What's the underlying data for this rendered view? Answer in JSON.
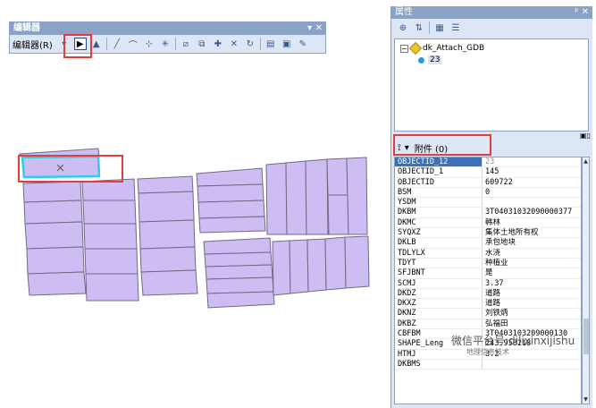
{
  "editor": {
    "title": "编辑器",
    "menu_label": "编辑器(R)",
    "title_controls": "▾ ✕"
  },
  "panel": {
    "title": "属性",
    "title_controls": "ᵖ ✕",
    "tree": {
      "layer_name": "dk_Attach_GDB",
      "feature_id": "23"
    },
    "attachments_label": "附件 (0)"
  },
  "attributes": [
    {
      "field": "OBJECTID_12",
      "value": "23"
    },
    {
      "field": "OBJECTID_1",
      "value": "145"
    },
    {
      "field": "OBJECTID",
      "value": "609722"
    },
    {
      "field": "BSM",
      "value": "0"
    },
    {
      "field": "YSDM",
      "value": ""
    },
    {
      "field": "DKBM",
      "value": "3T04031032090000377"
    },
    {
      "field": "DKMC",
      "value": "韩林"
    },
    {
      "field": "SYQXZ",
      "value": "集体土地所有权"
    },
    {
      "field": "DKLB",
      "value": "承包地块"
    },
    {
      "field": "TDLYLX",
      "value": "水浇"
    },
    {
      "field": "TDYT",
      "value": "种植业"
    },
    {
      "field": "SFJBNT",
      "value": "是"
    },
    {
      "field": "SCMJ",
      "value": "3.37"
    },
    {
      "field": "DKDZ",
      "value": "道路"
    },
    {
      "field": "DKXZ",
      "value": "道路"
    },
    {
      "field": "DKNZ",
      "value": "刘铁炳"
    },
    {
      "field": "DKBZ",
      "value": "弘福田"
    },
    {
      "field": "CBFBM",
      "value": "3T0403103209000130"
    },
    {
      "field": "SHAPE_Leng",
      "value": "243.958218"
    },
    {
      "field": "HTMJ",
      "value": "3.2"
    },
    {
      "field": "DKBMS",
      "value": ""
    }
  ],
  "watermark": {
    "line1": "微信平台号:dilixinxijishu",
    "line2": "地理信息技术"
  },
  "colors": {
    "parcel_fill": "#cdbdf2",
    "parcel_stroke": "#6f6a86",
    "selected_outline": "#29d0e0",
    "highlight_red": "#e23c3c"
  }
}
